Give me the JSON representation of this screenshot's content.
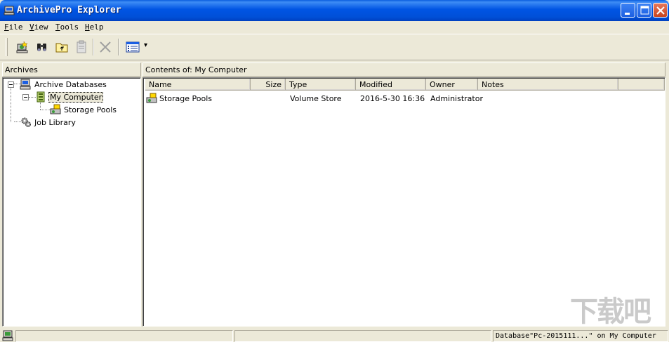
{
  "window": {
    "title": "ArchivePro Explorer"
  },
  "menu": {
    "items": [
      "File",
      "View",
      "Tools",
      "Help"
    ]
  },
  "toolbar": {
    "buttons": [
      "new-archive-icon",
      "find-binoculars-icon",
      "up-folder-icon",
      "properties-icon",
      "delete-icon",
      "view-options-icon"
    ],
    "view_dropdown": "▾"
  },
  "left_pane": {
    "header": "Archives",
    "tree": [
      {
        "label": "Archive Databases",
        "icon": "computer-icon",
        "level": 0,
        "expanded": true
      },
      {
        "label": "My Computer",
        "icon": "database-icon",
        "level": 1,
        "expanded": true,
        "selected": true
      },
      {
        "label": "Storage Pools",
        "icon": "storage-pool-icon",
        "level": 2
      },
      {
        "label": "Job Library",
        "icon": "gears-icon",
        "level": 0
      }
    ]
  },
  "right_pane": {
    "header": "Contents of: My Computer",
    "columns": [
      "Name",
      "Size",
      "Type",
      "Modified",
      "Owner",
      "Notes"
    ],
    "rows": [
      {
        "name": "Storage Pools",
        "size": "",
        "type": "Volume Store",
        "modified": "2016-5-30 16:36",
        "owner": "Administrator",
        "notes": ""
      }
    ]
  },
  "status_bar": {
    "panel1": "",
    "panel2": "",
    "panel3": "Database\"Pc-2015111...\" on My Computer"
  },
  "watermark": {
    "text": "下载吧"
  },
  "colors": {
    "title_bar": "#0054e3",
    "chrome": "#ece9d8",
    "close_button": "#c9451f"
  }
}
